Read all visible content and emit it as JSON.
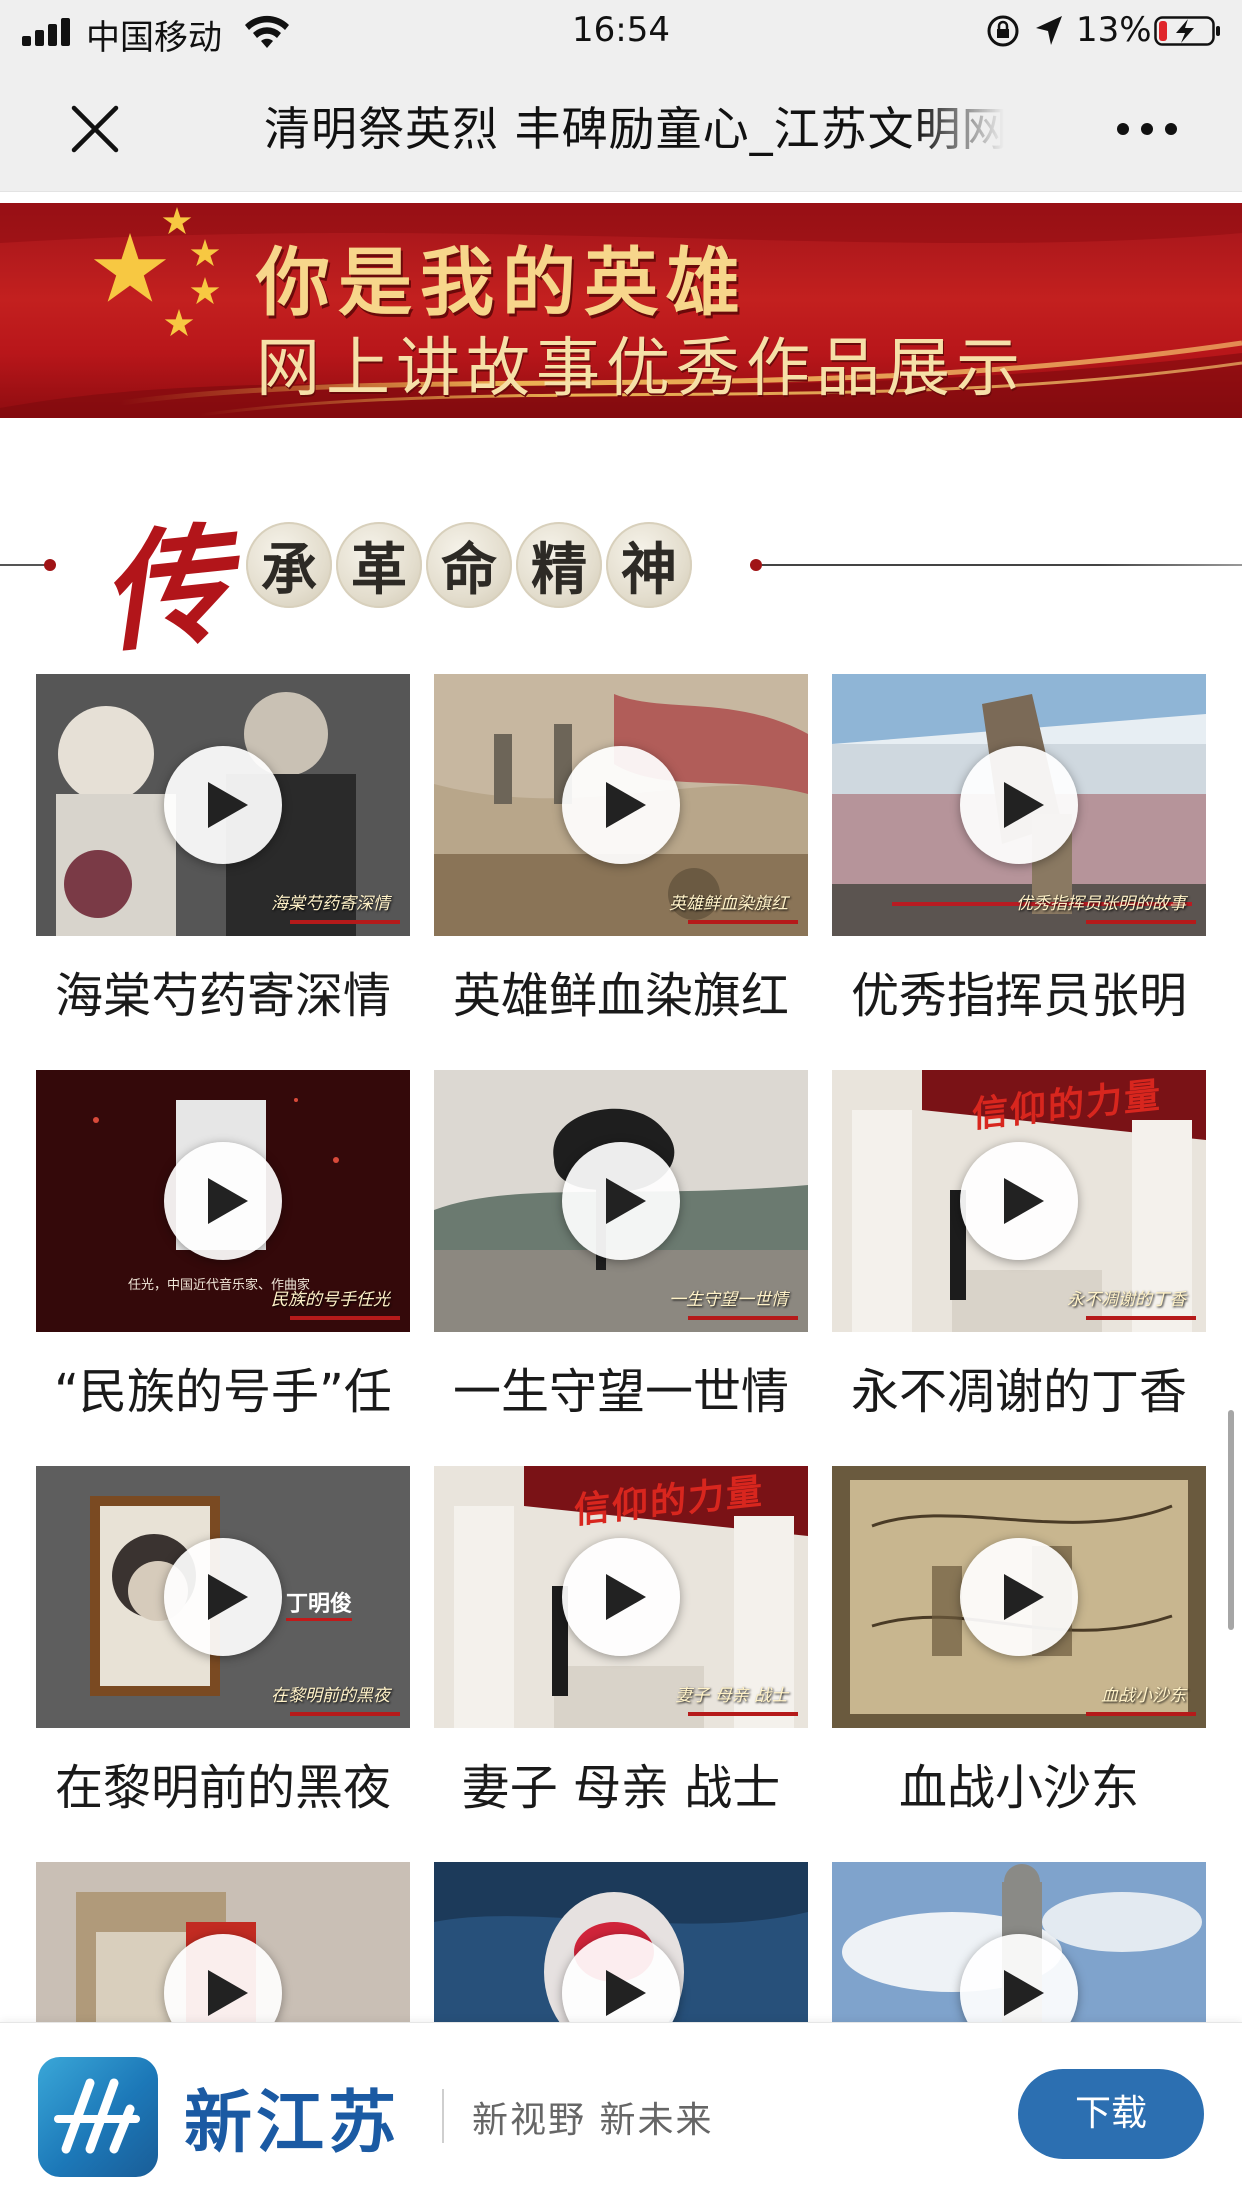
{
  "status_bar": {
    "carrier": "中国移动",
    "time": "16:54",
    "battery_percent": "13%"
  },
  "nav": {
    "title": "清明祭英烈 丰碑励童心_江苏文明网"
  },
  "banner": {
    "line1": "你是我的英雄",
    "line2": "网上讲故事优秀作品展示"
  },
  "section": {
    "big_char": "传",
    "circle_chars": [
      "承",
      "革",
      "命",
      "精",
      "神"
    ]
  },
  "videos": [
    {
      "title": "海棠芍药寄深情",
      "tag": "海棠芍药寄深情"
    },
    {
      "title": "英雄鲜血染旗红",
      "tag": "英雄鲜血染旗红"
    },
    {
      "title": "优秀指挥员张明",
      "tag": "优秀指挥员张明的故事"
    },
    {
      "title": "“民族的号手”任",
      "tag": "民族的号手任光",
      "subtext": "任光，中国近代音乐家、作曲家"
    },
    {
      "title": "一生守望一世情",
      "tag": "一生守望一世情"
    },
    {
      "title": "永不凋谢的丁香",
      "tag": "永不凋谢的丁香",
      "sign": "信仰的力量"
    },
    {
      "title": "在黎明前的黑夜",
      "tag": "在黎明前的黑夜",
      "name_label": "丁明俊"
    },
    {
      "title": "妻子  母亲  战士",
      "tag": "妻子 母亲 战士",
      "sign": "信仰的力量"
    },
    {
      "title": "血战小沙东",
      "tag": "血战小沙东"
    },
    {
      "title": "",
      "tag": ""
    },
    {
      "title": "",
      "tag": ""
    },
    {
      "title": "",
      "tag": ""
    }
  ],
  "appbar": {
    "app_name": "新江苏",
    "slogan": "新视野 新未来",
    "download_label": "下载"
  }
}
